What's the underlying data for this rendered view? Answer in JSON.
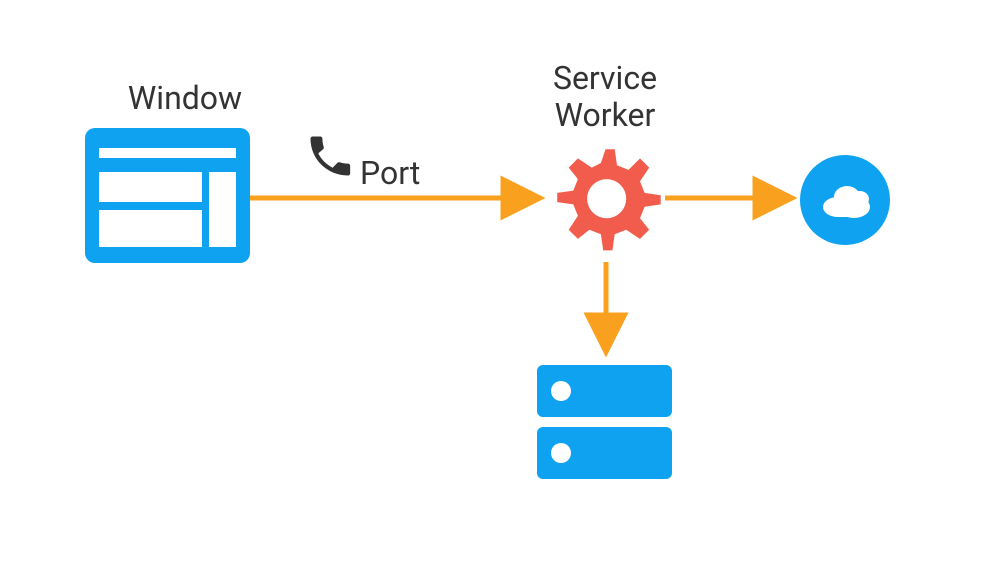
{
  "labels": {
    "window": "Window",
    "port": "Port",
    "service_worker_line1": "Service",
    "service_worker_line2": "Worker"
  },
  "nodes": {
    "window": {
      "name": "window-node"
    },
    "phone": {
      "name": "phone-icon"
    },
    "gear": {
      "name": "service-worker-gear"
    },
    "cloud": {
      "name": "cloud-node"
    },
    "storage": {
      "name": "storage-node"
    }
  },
  "colors": {
    "blue": "#0EA2F0",
    "red": "#F25C4D",
    "orange": "#F9A11E",
    "dark": "#333333",
    "white": "#FFFFFF"
  }
}
